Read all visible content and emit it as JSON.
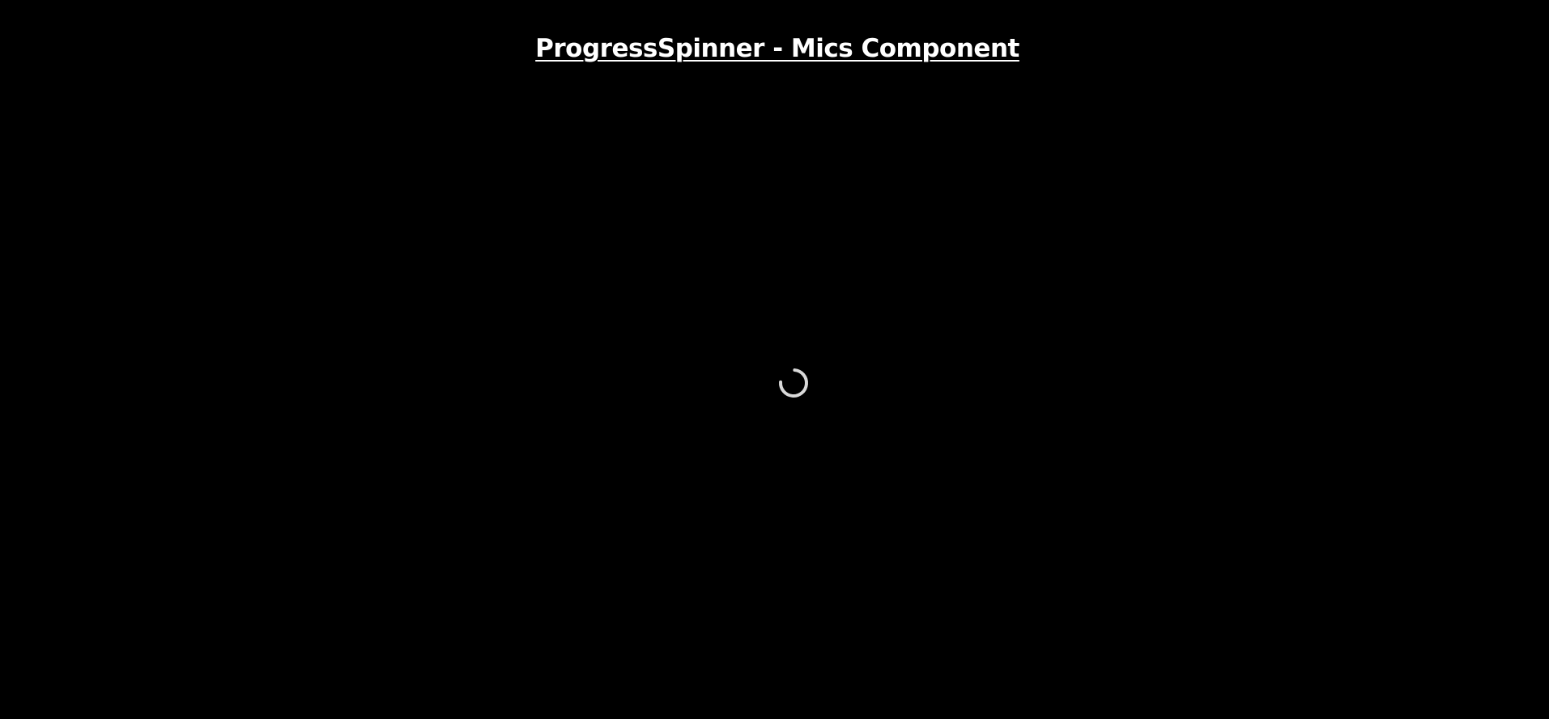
{
  "page": {
    "title": "ProgressSpinner - Mics Component"
  },
  "spinner": {
    "icon": "progress-spinner-icon",
    "color": "#d9d9d9",
    "background_color": "#000000"
  }
}
